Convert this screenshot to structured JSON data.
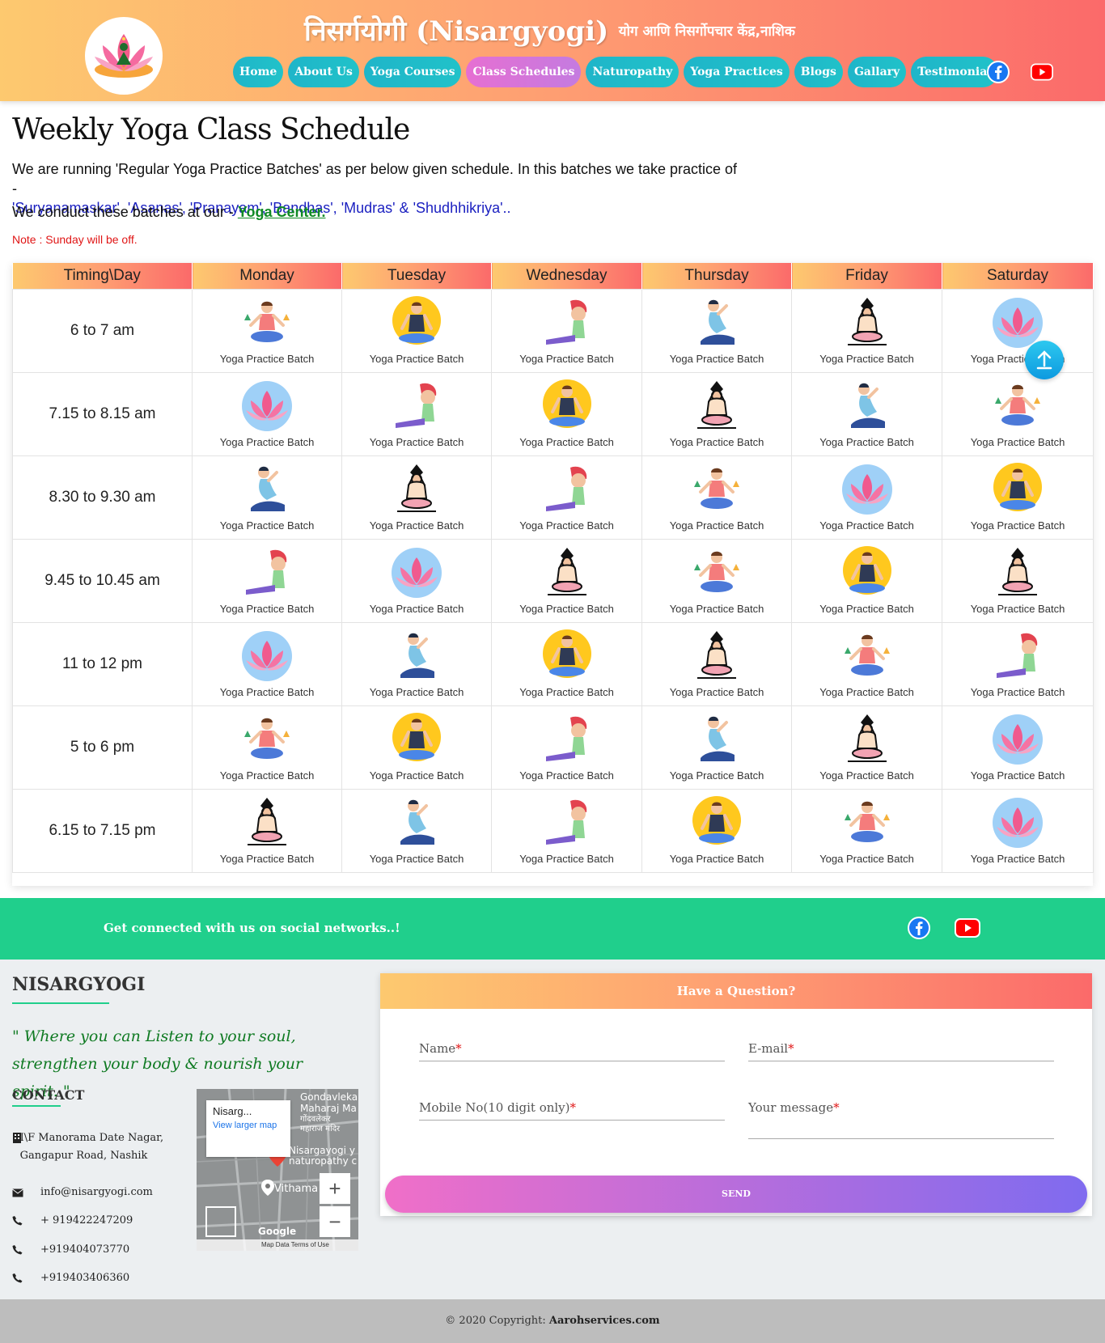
{
  "header": {
    "brand_main": "निसर्गयोगी (Nisargyogi)",
    "brand_sub": "योग आणि निसर्गोपचार केंद्र,नाशिक",
    "nav": [
      {
        "label": "Home"
      },
      {
        "label": "About Us"
      },
      {
        "label": "Yoga Courses"
      },
      {
        "label": "Class Schedules"
      },
      {
        "label": "Naturopathy"
      },
      {
        "label": "Yoga Practices"
      },
      {
        "label": "Blogs"
      },
      {
        "label": "Gallary"
      },
      {
        "label": "Testimonial"
      }
    ],
    "active_nav": "Class Schedules",
    "social_icons": [
      "facebook-icon",
      "youtube-icon"
    ]
  },
  "intro": {
    "title": "Weekly Yoga Class Schedule",
    "line1": "We are running 'Regular Yoga Practice Batches' as per below given schedule. In this batches we take practice of -",
    "line2": "'Suryanamaskar', 'Asanas', 'Pranayam', 'Bandhas', 'Mudras' & 'Shudhhikriya'..",
    "center_prefix": "We conduct these batches at our - ",
    "center_link": "Yoga Center.",
    "note": "Note : Sunday will be off."
  },
  "schedule": {
    "header_corner": "Timing\\Day",
    "days": [
      "Monday",
      "Tuesday",
      "Wednesday",
      "Thursday",
      "Friday",
      "Saturday"
    ],
    "batch_label": "Yoga Practice Batch",
    "rows": [
      {
        "time": "6 to 7 am",
        "icons": [
          "meditate-plants",
          "meditate-sun",
          "stretch-cap",
          "twist-pose",
          "meditate-outline",
          "lotus-flower"
        ]
      },
      {
        "time": "7.15 to 8.15 am",
        "icons": [
          "lotus-flower",
          "stretch-cap",
          "meditate-sun",
          "meditate-outline",
          "twist-pose",
          "meditate-plants"
        ]
      },
      {
        "time": "8.30 to 9.30 am",
        "icons": [
          "twist-pose",
          "meditate-outline",
          "stretch-cap",
          "meditate-plants",
          "lotus-flower",
          "meditate-sun"
        ]
      },
      {
        "time": "9.45 to 10.45 am",
        "icons": [
          "stretch-cap",
          "lotus-flower",
          "meditate-outline",
          "meditate-plants",
          "meditate-sun",
          "meditate-outline"
        ]
      },
      {
        "time": "11 to 12 pm",
        "icons": [
          "lotus-flower",
          "twist-pose",
          "meditate-sun",
          "meditate-outline",
          "meditate-plants",
          "stretch-cap"
        ]
      },
      {
        "time": "5 to 6 pm",
        "icons": [
          "meditate-plants",
          "meditate-sun",
          "stretch-cap",
          "twist-pose",
          "meditate-outline",
          "lotus-flower"
        ]
      },
      {
        "time": "6.15 to 7.15 pm",
        "icons": [
          "meditate-outline",
          "twist-pose",
          "stretch-cap",
          "meditate-sun",
          "meditate-plants",
          "lotus-flower"
        ]
      }
    ]
  },
  "social_bar": {
    "text": "Get connected with us on social networks..!",
    "icons": [
      "facebook-icon",
      "youtube-icon"
    ]
  },
  "footer": {
    "title": "NISARGYOGI",
    "quote": "\" Where you can Listen to your soul, strengthen your body & nourish your spirit. \"",
    "contact_title": "CONTACT",
    "address": "I\\F Manorama Date Nagar, Gangapur Road, Nashik",
    "email": "info@nisargyogi.com",
    "phones": [
      "+ 919422247209",
      "+919404073770",
      "+919403406360"
    ],
    "map": {
      "card_name": "Nisarg...",
      "card_link": "View larger map",
      "labels": [
        "Gondavleka",
        "Maharaj Ma",
        "गोंदवलेकर",
        "महाराज मंदिर",
        "Nisargayogi y",
        "naturopathy c",
        "Vithama"
      ],
      "footer": "Map Data   Terms of Use",
      "logo": "Google"
    },
    "form": {
      "title": "Have a Question?",
      "name": "Name",
      "email": "E-mail",
      "mobile": "Mobile No(10 digit only)",
      "message": "Your message",
      "required_mark": "*",
      "send": "SEND"
    }
  },
  "copyright": {
    "prefix": "© 2020 Copyright: ",
    "owner": "Aarohservices.com"
  },
  "colors": {
    "header_gradient": [
      "#fdc96f",
      "#fe9e72",
      "#fb6a6a"
    ],
    "nav_button": "#1fb5c9",
    "nav_active": "#e66fd2",
    "social_bar": "#20cf8c",
    "quote_green": "#0f7a22",
    "note_red": "#e01515",
    "link_green": "#0f8a24",
    "highlight_blue": "#1a1fc0"
  }
}
